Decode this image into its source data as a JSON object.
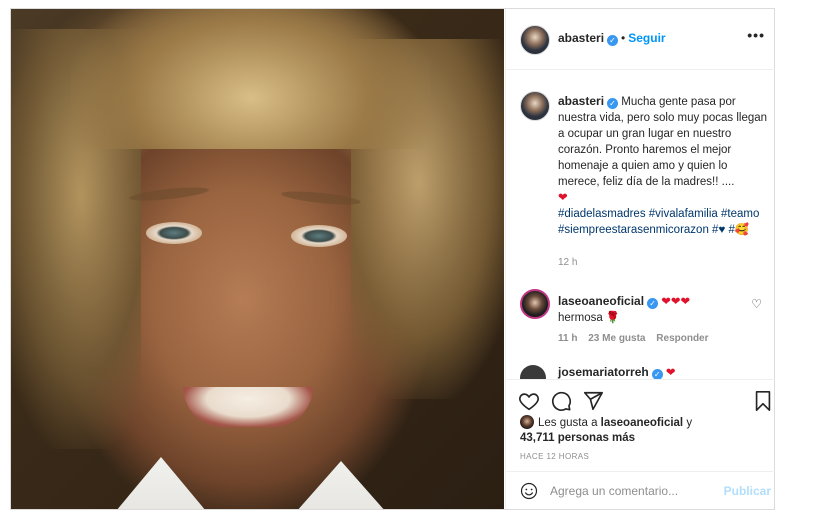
{
  "post": {
    "username": "abasteri",
    "follow_label": "Seguir",
    "more_label": "•••",
    "caption_text": "Mucha gente pasa por nuestra vida, pero solo muy pocas llegan a ocupar un gran lugar en nuestro corazón. Pronto haremos el mejor homenaje a quien amo y quien lo merece, feliz día de la madres!! ....",
    "caption_heart": "❤",
    "hashtags": "#diadelasmadres #vivalafamilia #teamo #siempreestarasenmicorazon #♥ #🥰",
    "caption_time": "12 h"
  },
  "comments": [
    {
      "username": "laseoaneoficial",
      "hearts": "❤❤❤",
      "text": "hermosa 🌹",
      "time": "11 h",
      "likes": "23 Me gusta",
      "reply": "Responder"
    },
    {
      "username": "josemariatorreh",
      "hearts": "❤"
    }
  ],
  "likes": {
    "prefix": "Les gusta a",
    "user": "laseoaneoficial",
    "suffix": "y",
    "others": "43,711 personas más"
  },
  "posted_ago": "HACE 12 HORAS",
  "add_comment": {
    "placeholder": "Agrega un comentario...",
    "post_label": "Publicar"
  },
  "colors": {
    "link": "#0095f6",
    "hashtag": "#00376b",
    "heart": "#e0112b",
    "muted": "#8e8e8e"
  }
}
